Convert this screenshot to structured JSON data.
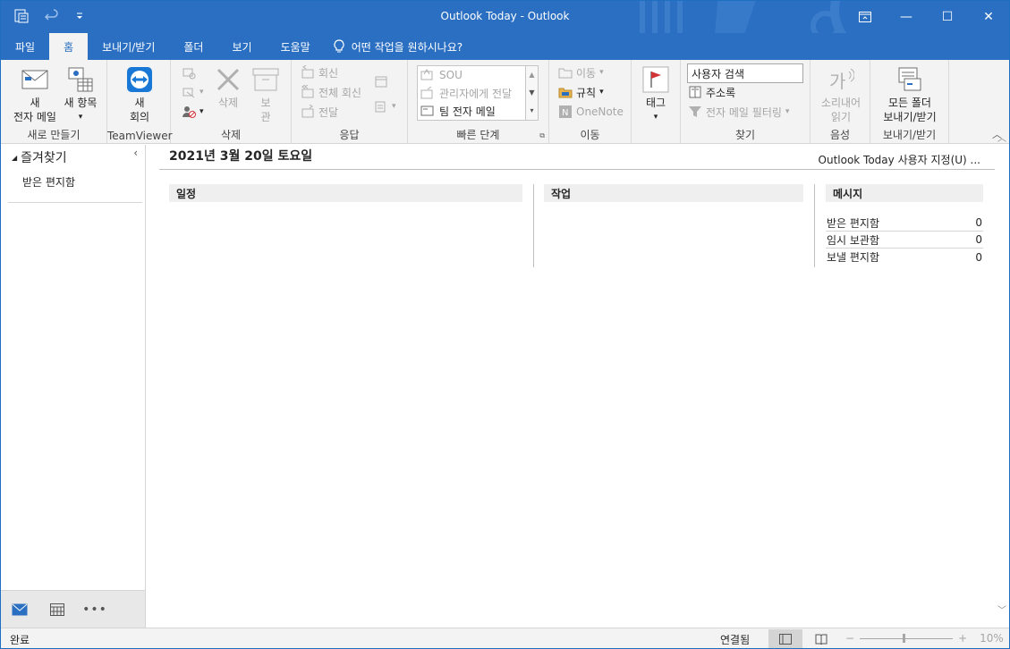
{
  "window": {
    "title": "Outlook Today  -  Outlook",
    "controls": {
      "restore_icon": "restore-icon",
      "minimize": "—",
      "maximize": "☐",
      "close": "✕"
    }
  },
  "tabs": [
    {
      "label": "파일"
    },
    {
      "label": "홈"
    },
    {
      "label": "보내기/받기"
    },
    {
      "label": "폴더"
    },
    {
      "label": "보기"
    },
    {
      "label": "도움말"
    }
  ],
  "tell_me": "어떤 작업을 원하시나요?",
  "ribbon": {
    "new": {
      "new_email_l1": "새",
      "new_email_l2": "전자 메일",
      "new_items": "새 항목",
      "group": "새로 만들기"
    },
    "teamviewer": {
      "label_l1": "새",
      "label_l2": "회의",
      "group": "TeamViewer"
    },
    "delete": {
      "delete": "삭제",
      "archive_l1": "보",
      "archive_l2": "관",
      "group": "삭제"
    },
    "respond": {
      "reply": "회신",
      "reply_all": "전체 회신",
      "forward": "전달",
      "group": "응답"
    },
    "quicksteps": {
      "item1": "SOU",
      "item2": "관리자에게 전달",
      "item3": "팀 전자 메일",
      "group": "빠른 단계"
    },
    "move": {
      "move": "이동",
      "rules": "규칙",
      "onenote": "OneNote",
      "group": "이동"
    },
    "tags": {
      "label": "태그"
    },
    "find": {
      "search_people": "사용자 검색",
      "address_book": "주소록",
      "filter_email": "전자 메일 필터링",
      "group": "찾기"
    },
    "speech": {
      "read_l1": "소리내어",
      "read_l2": "읽기",
      "group": "음성"
    },
    "sendreceive": {
      "l1": "모든 폴더",
      "l2": "보내기/받기",
      "group": "보내기/받기"
    }
  },
  "nav": {
    "favorites": "즐겨찾기",
    "items": [
      {
        "label": "받은 편지함"
      }
    ],
    "bottom_icons": [
      "mail-icon",
      "calendar-icon",
      "more-icon"
    ],
    "more": "•••"
  },
  "main": {
    "date": "2021년 3월 20일 토요일",
    "customize": "Outlook Today 사용자 지정(U) ...",
    "columns": {
      "calendar": "일정",
      "tasks": "작업",
      "messages": "메시지"
    },
    "messages": [
      {
        "folder": "받은 편지함",
        "count": "0"
      },
      {
        "folder": "임시 보관함",
        "count": "0"
      },
      {
        "folder": "보낼 편지함",
        "count": "0"
      }
    ]
  },
  "status": {
    "left": "완료",
    "connection": "연결됨",
    "zoom": "10%"
  },
  "colors": {
    "accent": "#2b6fc2",
    "ribbon_bg": "#f3f3f3"
  }
}
